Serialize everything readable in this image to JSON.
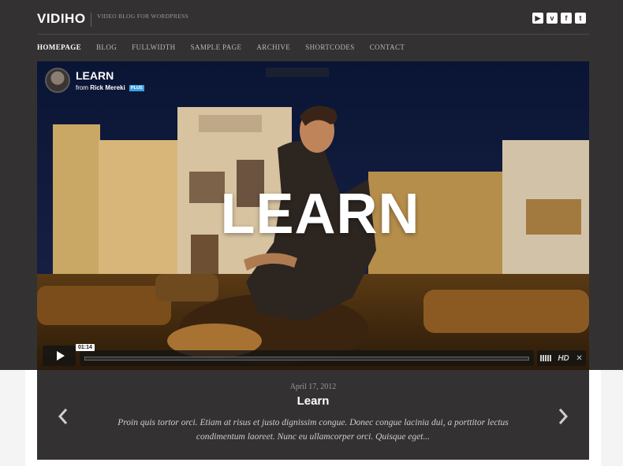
{
  "site": {
    "logo": "VIDIHO",
    "tagline": "VIDEO BLOG FOR WORDPRESS"
  },
  "social": [
    {
      "icon": "youtube-icon",
      "glyph": "▶"
    },
    {
      "icon": "vimeo-icon",
      "glyph": "v"
    },
    {
      "icon": "facebook-icon",
      "glyph": "f"
    },
    {
      "icon": "twitter-icon",
      "glyph": "t"
    }
  ],
  "nav": [
    {
      "label": "HOMEPAGE",
      "active": true
    },
    {
      "label": "BLOG"
    },
    {
      "label": "FULLWIDTH"
    },
    {
      "label": "SAMPLE PAGE"
    },
    {
      "label": "ARCHIVE"
    },
    {
      "label": "SHORTCODES"
    },
    {
      "label": "CONTACT"
    }
  ],
  "video": {
    "title": "LEARN",
    "overlay_text": "LEARN",
    "from_prefix": "from",
    "author": "Rick Mereki",
    "badge": "PLUS",
    "time": "01:14",
    "hd_label": "HD",
    "progress": 0
  },
  "post": {
    "date": "April 17, 2012",
    "title": "Learn",
    "excerpt": "Proin quis tortor orci. Etiam at risus et justo dignissim congue. Donec congue lacinia dui, a porttitor lectus condimentum laoreet. Nunc eu ullamcorper orci. Quisque eget..."
  },
  "colors": {
    "background_dark": "#333132",
    "accent_badge": "#3ba2e1",
    "text_light": "#ffffff"
  }
}
